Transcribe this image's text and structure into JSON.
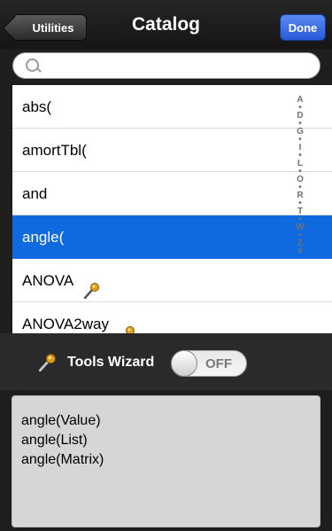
{
  "nav": {
    "back_label": "Utilities",
    "title": "Catalog",
    "done_label": "Done"
  },
  "search": {
    "placeholder": ""
  },
  "list": {
    "items": [
      {
        "label": "abs(",
        "selected": false,
        "has_wand": false
      },
      {
        "label": "amortTbl(",
        "selected": false,
        "has_wand": false
      },
      {
        "label": "and",
        "selected": false,
        "has_wand": false
      },
      {
        "label": "angle(",
        "selected": true,
        "has_wand": false
      },
      {
        "label": "ANOVA",
        "selected": false,
        "has_wand": true
      },
      {
        "label": "ANOVA2way",
        "selected": false,
        "has_wand": true
      }
    ]
  },
  "index": [
    "A",
    "•",
    "D",
    "•",
    "G",
    "•",
    "I",
    "•",
    "L",
    "•",
    "O",
    "•",
    "R",
    "•",
    "T",
    "•",
    "W",
    "•",
    "Z",
    "#"
  ],
  "tools": {
    "label": "Tools Wizard",
    "toggle_text": "OFF",
    "toggle_on": false
  },
  "help": {
    "lines": [
      "angle(Value)",
      "angle(List)",
      "angle(Matrix)"
    ]
  },
  "colors": {
    "selected": "#0f6ae0",
    "done_button": "#2a5ad8",
    "wand": "#e0a020"
  }
}
